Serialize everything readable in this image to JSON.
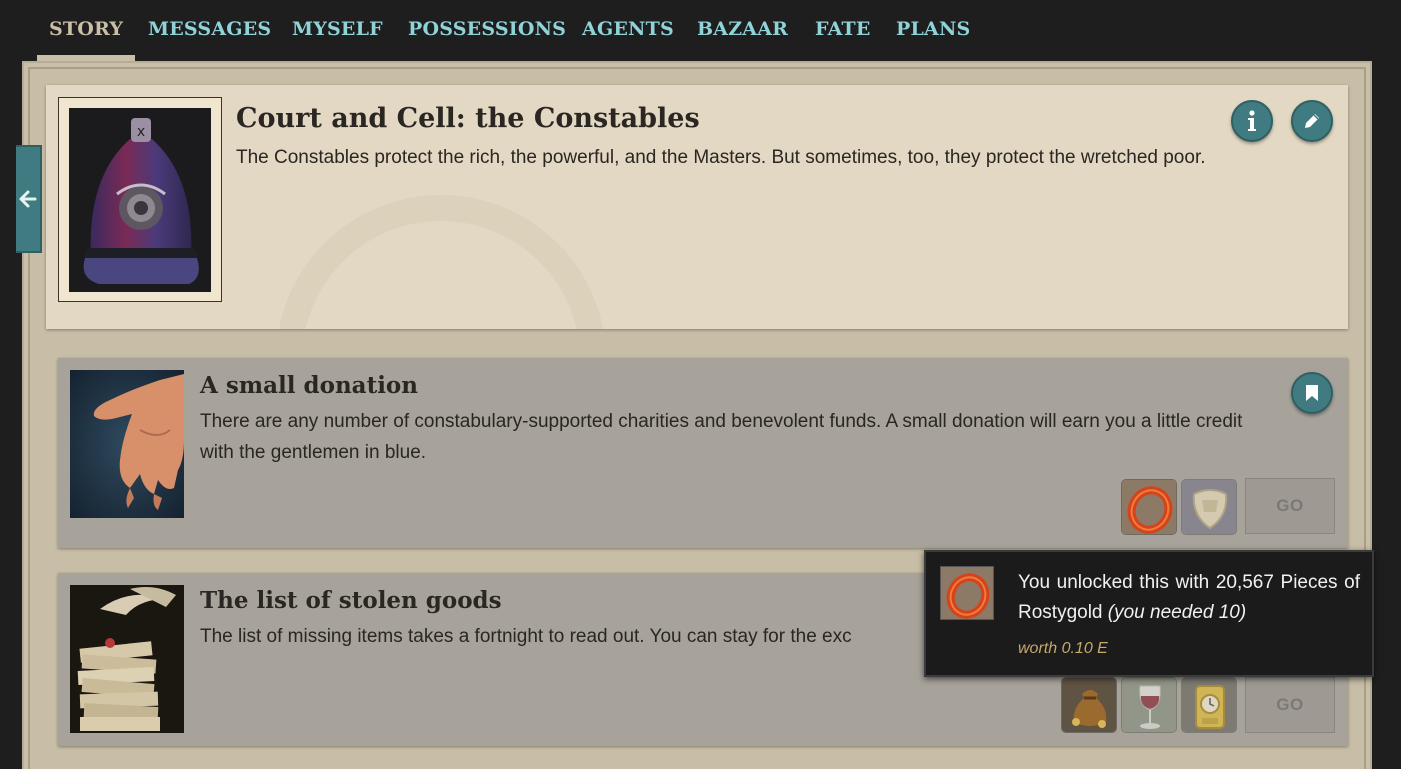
{
  "nav": {
    "tabs": [
      {
        "label": "STORY",
        "active": true
      },
      {
        "label": "MESSAGES"
      },
      {
        "label": "MYSELF"
      },
      {
        "label": "POSSESSIONS"
      },
      {
        "label": "AGENTS"
      },
      {
        "label": "BAZAAR"
      },
      {
        "label": "FATE"
      },
      {
        "label": "PLANS"
      }
    ]
  },
  "side_tab": {
    "icon": "arrow-left-icon"
  },
  "header": {
    "title": "Court and Cell: the Constables",
    "description": "The Constables protect the rich, the powerful, and the Masters. But sometimes, too, they protect the wretched poor.",
    "image": "constable-helmet",
    "info_icon": "info-icon",
    "edit_icon": "pencil-icon"
  },
  "storylets": [
    {
      "title": "A small donation",
      "description": "There are any number of constabulary-supported charities and benevolent funds. A small donation will earn you a little credit with the gentlemen in blue.",
      "image": "open-hand",
      "bookmark_icon": "bookmark-icon",
      "requirements": [
        "rostygold-ring-icon",
        "shield-crest-icon"
      ],
      "go_label": "GO"
    },
    {
      "title": "The list of stolen goods",
      "description": "The list of missing items takes a fortnight to read out. You can stay for the exc",
      "image": "stack-of-cards",
      "requirements": [
        "money-bag-icon",
        "wine-glass-icon",
        "gold-clock-icon"
      ],
      "go_label": "GO"
    }
  ],
  "tooltip": {
    "icon": "rostygold-ring-icon",
    "text_main": "You unlocked this with 20,567 Pieces of Rostygold",
    "text_italic": "(you needed 10)",
    "worth": "worth 0.10 E"
  },
  "colors": {
    "accent": "#3f7b80",
    "nav_link": "#8fd3d8",
    "nav_active": "#c9bfa6",
    "worth_gold": "#c7a96a"
  }
}
